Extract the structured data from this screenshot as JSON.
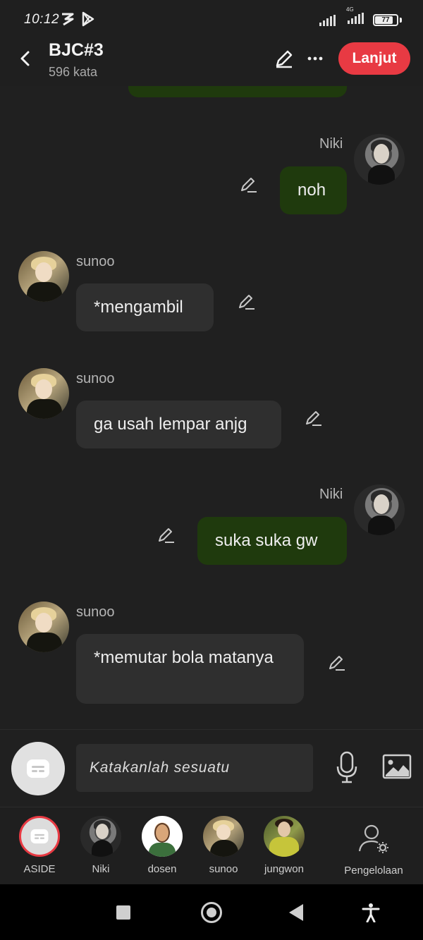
{
  "status_bar": {
    "time": "10:12",
    "network": "4G",
    "battery": "77"
  },
  "header": {
    "title": "BJC#3",
    "subtitle": "596 kata",
    "primary_action": "Lanjut"
  },
  "messages": [
    {
      "sender": "Niki",
      "text": "noh",
      "side": "right"
    },
    {
      "sender": "sunoo",
      "text": "*mengambil",
      "side": "left"
    },
    {
      "sender": "sunoo",
      "text": "ga usah lempar anjg",
      "side": "left"
    },
    {
      "sender": "Niki",
      "text": "suka suka gw",
      "side": "right"
    },
    {
      "sender": "sunoo",
      "text": "*memutar bola matanya",
      "side": "left"
    }
  ],
  "composer": {
    "placeholder": "Katakanlah sesuatu"
  },
  "characters": [
    {
      "label": "ASIDE"
    },
    {
      "label": "Niki"
    },
    {
      "label": "dosen"
    },
    {
      "label": "sunoo"
    },
    {
      "label": "jungwon"
    }
  ],
  "manage": {
    "label": "Pengelolaan"
  },
  "colors": {
    "accent": "#e83a43",
    "outgoing_bubble": "#1f3a0d",
    "incoming_bubble": "#2f2f2f",
    "background": "#202020"
  },
  "icons": [
    "back-arrow-icon",
    "pencil-icon",
    "more-icon",
    "mic-icon",
    "image-icon",
    "chat-bubble-icon",
    "user-settings-icon"
  ]
}
